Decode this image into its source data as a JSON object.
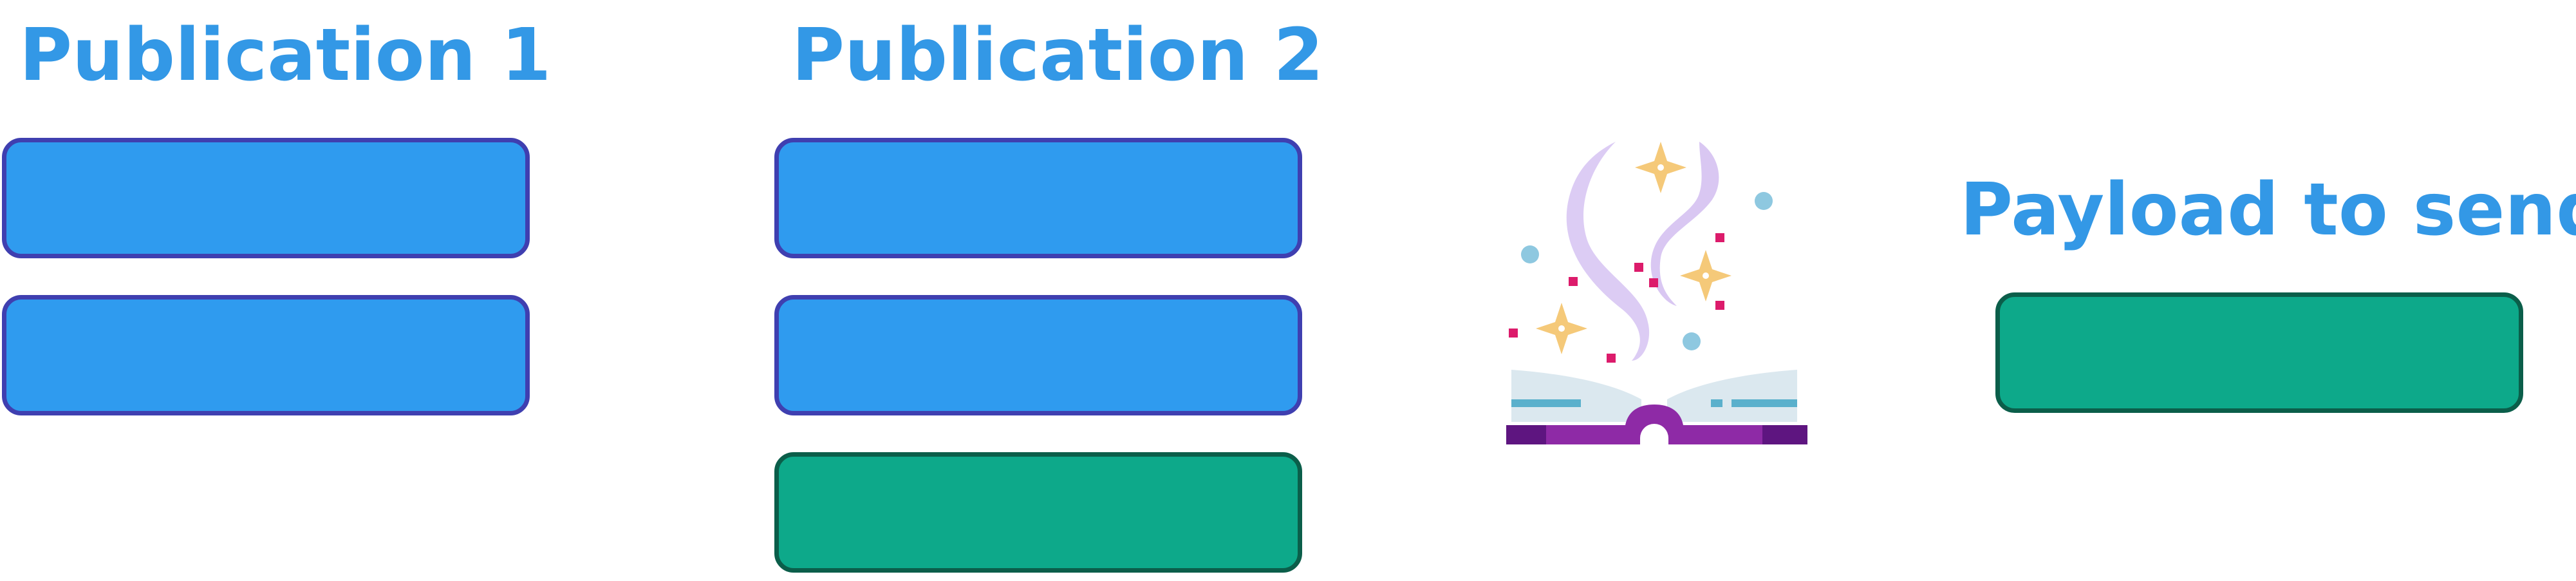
{
  "publication_1": {
    "title": "Publication 1",
    "blocks": [
      {
        "color": "#2f9bef"
      },
      {
        "color": "#2f9bef"
      }
    ]
  },
  "publication_2": {
    "title": "Publication 2",
    "blocks": [
      {
        "color": "#2f9bef"
      },
      {
        "color": "#2f9bef"
      },
      {
        "color": "#0da98a"
      }
    ]
  },
  "payload": {
    "title": "Payload to send",
    "blocks": [
      {
        "color": "#0da98a"
      }
    ]
  },
  "illustration": {
    "icon": "magic-book-icon"
  },
  "colors": {
    "heading": "#3398e6",
    "blue_block": "#2f9bef",
    "blue_border": "#3f3fb0",
    "green_block": "#0da98a",
    "green_border": "#0b5e4a"
  }
}
